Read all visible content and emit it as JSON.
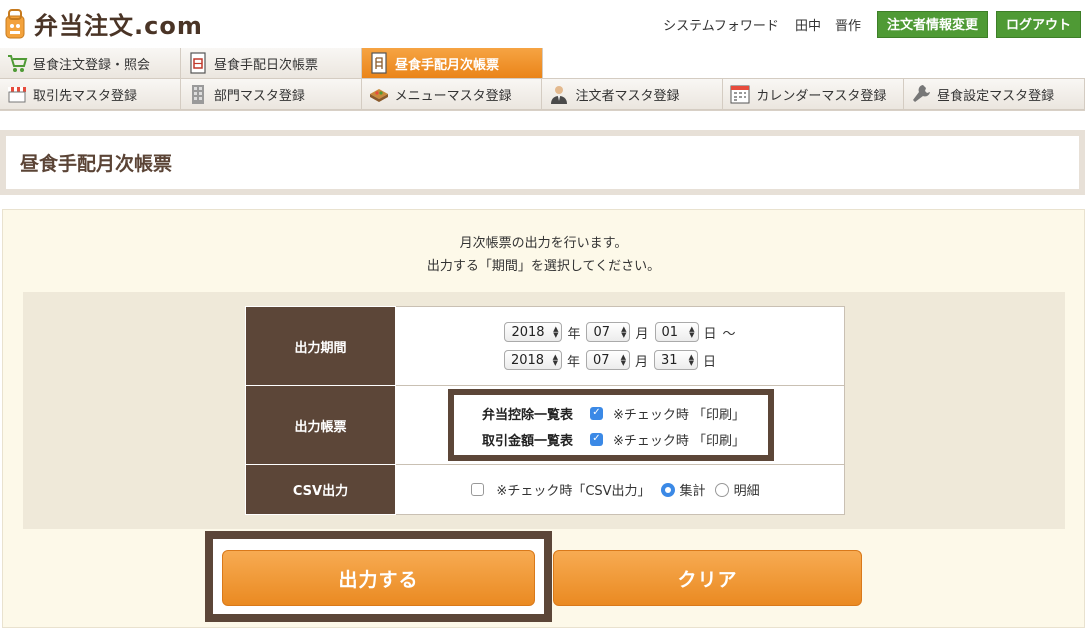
{
  "header": {
    "logo_text": "弁当注文.com",
    "company": "システムフォワード",
    "user_last": "田中",
    "user_first": "晋作",
    "profile_button": "注文者情報変更",
    "logout_button": "ログアウト"
  },
  "nav": {
    "row1": [
      {
        "label": "昼食注文登録・照会",
        "icon": "cart-icon"
      },
      {
        "label": "昼食手配日次帳票",
        "icon": "daily-report-icon"
      },
      {
        "label": "昼食手配月次帳票",
        "icon": "monthly-report-icon",
        "active": true
      }
    ],
    "row2": [
      {
        "label": "取引先マスタ登録",
        "icon": "shop-icon"
      },
      {
        "label": "部門マスタ登録",
        "icon": "building-icon"
      },
      {
        "label": "メニューマスタ登録",
        "icon": "bento-icon"
      },
      {
        "label": "注文者マスタ登録",
        "icon": "person-icon"
      },
      {
        "label": "カレンダーマスタ登録",
        "icon": "calendar-icon"
      },
      {
        "label": "昼食設定マスタ登録",
        "icon": "wrench-icon"
      }
    ]
  },
  "page_title": "昼食手配月次帳票",
  "intro": {
    "line1": "月次帳票の出力を行います。",
    "line2": "出力する「期間」を選択してください。"
  },
  "form": {
    "period_label": "出力期間",
    "from": {
      "year": "2018",
      "month": "07",
      "day": "01"
    },
    "to": {
      "year": "2018",
      "month": "07",
      "day": "31"
    },
    "unit_year": "年",
    "unit_month": "月",
    "unit_day": "日",
    "range_sep": "〜",
    "report_label": "出力帳票",
    "reports": [
      {
        "label": "弁当控除一覧表",
        "checked": true,
        "note": "※チェック時 「印刷」"
      },
      {
        "label": "取引金額一覧表",
        "checked": true,
        "note": "※チェック時 「印刷」"
      }
    ],
    "csv_label": "CSV出力",
    "csv_checked": false,
    "csv_note": "※チェック時「CSV出力」",
    "csv_options": [
      {
        "label": "集計",
        "selected": true
      },
      {
        "label": "明細",
        "selected": false
      }
    ]
  },
  "buttons": {
    "output": "出力する",
    "clear": "クリア"
  },
  "colors": {
    "brand_brown": "#5c4638",
    "accent_orange": "#ea8a22",
    "green": "#4f9a35",
    "checkbox_blue": "#3b89e6"
  }
}
